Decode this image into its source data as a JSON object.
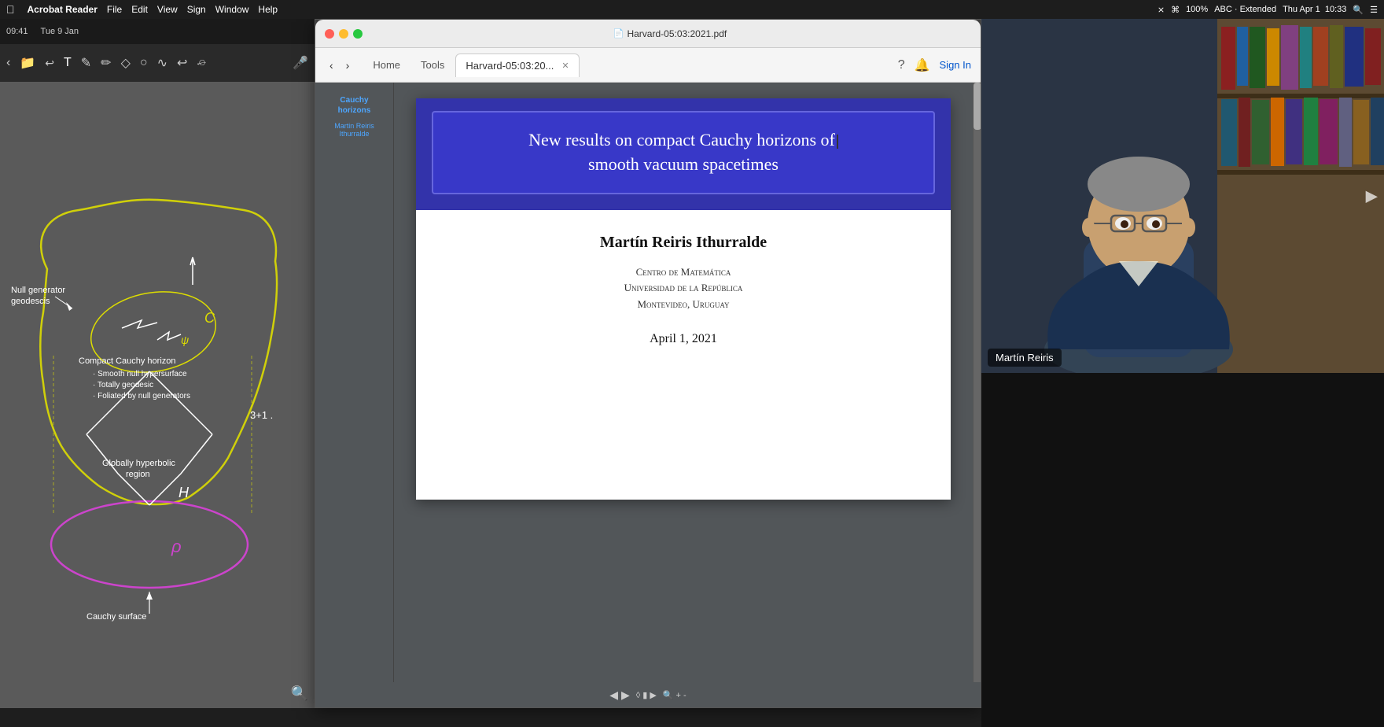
{
  "menubar": {
    "apple": "&#63743;",
    "items": [
      "Acrobat Reader",
      "File",
      "Edit",
      "View",
      "Sign",
      "Window",
      "Help"
    ],
    "right_items": [
      "100%",
      "ABC",
      "Extended",
      "Thu Apr 1",
      "10:33"
    ]
  },
  "timebar": {
    "time": "09:41",
    "date": "Tue 9 Jan"
  },
  "acrobat": {
    "title": "Harvard-05:03:2021.pdf",
    "window_title": "Harvard-05:03:20...",
    "tabs": {
      "home": "Home",
      "tools": "Tools",
      "document": "Harvard-05:03:20..."
    },
    "toolbar_buttons": {
      "back": "&#8249;",
      "forward": "&#8250;"
    },
    "right_toolbar": {
      "help": "?",
      "bell": "&#128276;",
      "sign_in": "Sign In"
    }
  },
  "thumbnail": {
    "label": "Cauchy\nhorizons",
    "author": "Martin Reiris\nIthurralde"
  },
  "pdf": {
    "title_line1": "New results on compact Cauchy horizons of",
    "title_line2": "smooth vacuum spacetimes",
    "author": "Martín Reiris Ithurralde",
    "institution_line1": "Centro de Matemática",
    "institution_line2": "Universidad de la República",
    "institution_line3": "Montevideo, Uruguay",
    "date": "April 1, 2021"
  },
  "whiteboard": {
    "labels": {
      "null_generator": "Null generator\ngeodescis",
      "compact_cauchy": "Compact Cauchy horizon",
      "bullet1": "· Smooth null hypersurface",
      "bullet2": "· Totally geodesic",
      "bullet3": "· Foliated by null generators",
      "globally_hyperbolic": "Globally hyperbolic\nregion",
      "cauchy_surface": "Cauchy surface",
      "h_label": "H",
      "dim_label": "3+1 ."
    }
  },
  "video": {
    "person_name": "Martín Reiris"
  },
  "colors": {
    "pdf_header_blue": "#3333aa",
    "pdf_title_box": "#3838c8",
    "acrobat_bg": "#525659",
    "yellow_annotation": "#ffee00",
    "purple_annotation": "#aa44aa",
    "whiteboard_bg": "#5a5a5a"
  }
}
